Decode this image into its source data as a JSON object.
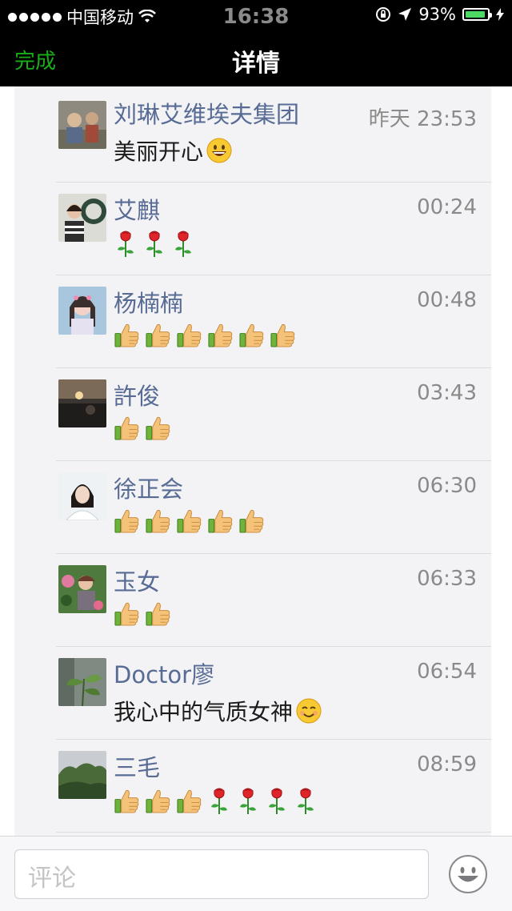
{
  "status": {
    "carrier": "中国移动",
    "time": "16:38",
    "battery": "93%",
    "battery_level": 0.93
  },
  "header": {
    "done_label": "完成",
    "title": "详情"
  },
  "comments": [
    {
      "name": "刘琳艾维埃夫集团",
      "time": "昨天 23:53",
      "text": "美丽开心",
      "trailing_emoji": "grinning-face"
    },
    {
      "name": "艾麒",
      "time": "00:24",
      "emojis": [
        "rose",
        "rose",
        "rose"
      ]
    },
    {
      "name": "杨楠楠",
      "time": "00:48",
      "emojis": [
        "thumbs-up",
        "thumbs-up",
        "thumbs-up",
        "thumbs-up",
        "thumbs-up",
        "thumbs-up"
      ]
    },
    {
      "name": "許俊",
      "time": "03:43",
      "emojis": [
        "thumbs-up",
        "thumbs-up"
      ]
    },
    {
      "name": "徐正会",
      "time": "06:30",
      "emojis": [
        "thumbs-up",
        "thumbs-up",
        "thumbs-up",
        "thumbs-up",
        "thumbs-up"
      ]
    },
    {
      "name": "玉女",
      "time": "06:33",
      "emojis": [
        "thumbs-up",
        "thumbs-up"
      ]
    },
    {
      "name": "Doctor廖",
      "time": "06:54",
      "text": "我心中的气质女神",
      "trailing_emoji": "smiling-face"
    },
    {
      "name": "三毛",
      "time": "08:59",
      "emojis": [
        "thumbs-up",
        "thumbs-up",
        "thumbs-up",
        "rose",
        "rose",
        "rose",
        "rose"
      ]
    }
  ],
  "input": {
    "placeholder": "评论"
  },
  "colors": {
    "accent": "#1aad19",
    "name": "#576b95",
    "time": "#8a8a8a"
  }
}
